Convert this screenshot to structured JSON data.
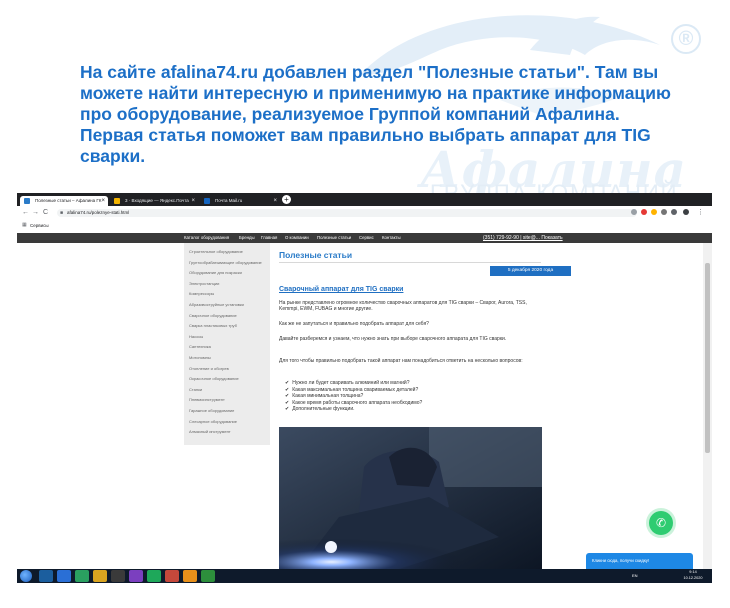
{
  "headline": "На сайте afalina74.ru добавлен раздел \"Полезные статьи\". Там вы можете найти интересную и применимую на практике информацию про оборудование, реализуемое Группой компаний Афалина. Первая статья поможет вам правильно выбрать аппарат для TIG сварки.",
  "watermark": {
    "brand": "Афалина",
    "sub": "ГРУППА КОМПАНИЙ",
    "reg": "®"
  },
  "browser": {
    "tabs": [
      {
        "label": "Полезные статьи – Афалина ГК",
        "color": "#2a7bc8"
      },
      {
        "label": "3 · Входящие — Яндекс.Почта",
        "color": "#f4b400"
      },
      {
        "label": "Почта Mail.ru",
        "color": "#1565c0"
      }
    ],
    "close_glyph": "×",
    "new_tab_glyph": "+",
    "url": "afalina74.ru/poleznye-stati.html",
    "bookmarks_label": "Сервисы",
    "back_glyph": "←",
    "forward_glyph": "→",
    "reload_glyph": "C"
  },
  "site": {
    "nav": [
      "Каталог оборудования",
      "Бренды",
      "Главная",
      "О компании",
      "Полезные статьи",
      "Сервис",
      "Контакты"
    ],
    "phone": "(351) 729-92-90  |  site@...   Показать",
    "sidebar": [
      "Строительное оборудование",
      "Грунтообрабатывающее оборудование",
      "Оборудование для покраски",
      "Электростанции",
      "Компрессоры",
      "Абразивоструйные установки",
      "Сварочное оборудование",
      "Сварка пластиковых труб",
      "Насосы",
      "Сантехника",
      "Мотопомпы",
      "Отопление и обогрев",
      "Окрасочное оборудование",
      "Станки",
      "Пневмоинструмент",
      "Гаражное оборудование",
      "Слесарное оборудование",
      "Алмазный инструмент"
    ],
    "page_title": "Полезные статьи",
    "date": "5 декабря 2020 года",
    "article_title": "Сварочный аппарат для TIG сварки",
    "paragraphs": [
      "На рынке представлено огромное количество сварочных аппаратов для TIG сварки – Сварог, Aurora, TSS, Kemmpi, EWM, FUBAG и многие другие.",
      "Как же не запутаться и правильно подобрать аппарат для себя?",
      "Давайте разберемся и узнаем, что нужно знать при выборе сварочного аппарата для TIG сварки.",
      "Для того чтобы правильно подобрать такой аппарат нам понадобиться ответить на несколько вопросов:"
    ],
    "questions": [
      "Нужно ли будет сваривать алюминий или магний?",
      "Какая максимальная толщина свариваемых деталей?",
      "Какая минимальная толщина?",
      "Какое время работы сварочного аппарата необходимо?",
      "Дополнительные функции."
    ],
    "check_glyph": "✔",
    "chat_text": "Кликни сюда, получи скидку!",
    "call_glyph": "✆"
  },
  "taskbar": {
    "lang": "EN",
    "time": "9:14",
    "date": "10.12.2020"
  },
  "colors": {
    "accent": "#1c6fc7",
    "site_blue": "#1f6fc2",
    "call_green": "#2ecc71"
  }
}
